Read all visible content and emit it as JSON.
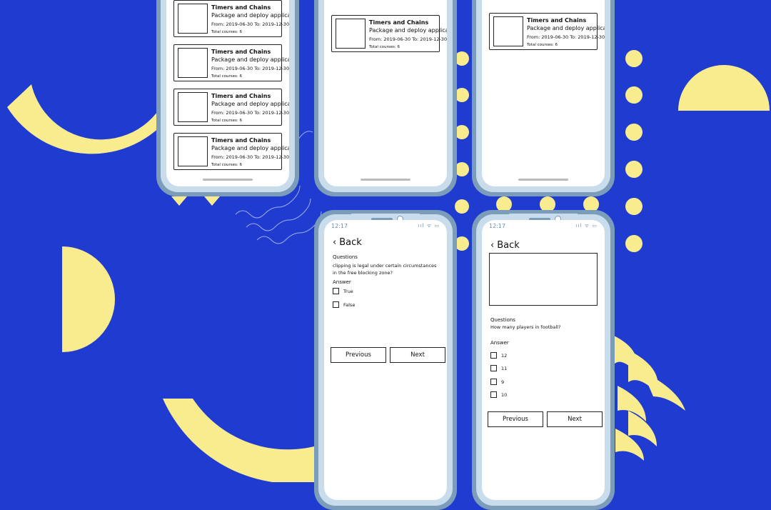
{
  "colors": {
    "background": "#1f3bd0",
    "accent": "#f9ec8f",
    "phone_frame": "#7c9db9",
    "phone_bezel": "#c9dcec"
  },
  "course_card": {
    "title": "Timers and Chains",
    "subtitle": "Package and deploy applicationst...",
    "dates": "From: 2019-06-30   To: 2019-12-30",
    "total": "Total courses: 6"
  },
  "phone1": {
    "cards": [
      {
        "title": "Timers and Chains",
        "subtitle": "Package and deploy applicationst...",
        "dates": "From: 2019-06-30   To: 2019-12-30",
        "total": "Total courses: 6"
      },
      {
        "title": "Timers and Chains",
        "subtitle": "Package and deploy applicationst...",
        "dates": "From: 2019-06-30   To: 2019-12-30",
        "total": "Total courses: 6"
      },
      {
        "title": "Timers and Chains",
        "subtitle": "Package and deploy applicationst...",
        "dates": "From: 2019-06-30   To: 2019-12-30",
        "total": "Total courses: 6"
      },
      {
        "title": "Timers and Chains",
        "subtitle": "Package and deploy applicationst...",
        "dates": "From: 2019-06-30   To: 2019-12-30",
        "total": "Total courses: 6"
      }
    ]
  },
  "quiz1": {
    "time": "12:17",
    "back_label": "Back",
    "question_label": "Questions",
    "question_text": "clipping is legal under certain circumstances in the free blocking zone?",
    "answer_label": "Answer",
    "options": [
      "True",
      "False"
    ],
    "prev_label": "Previous",
    "next_label": "Next"
  },
  "quiz2": {
    "time": "12:17",
    "back_label": "Back",
    "question_label": "Questions",
    "question_text": "How many players in football?",
    "answer_label": "Answer",
    "options": [
      "12",
      "11",
      "9",
      "10"
    ],
    "prev_label": "Previous",
    "next_label": "Next"
  },
  "status_icons": "ııl ᯤ ▭"
}
